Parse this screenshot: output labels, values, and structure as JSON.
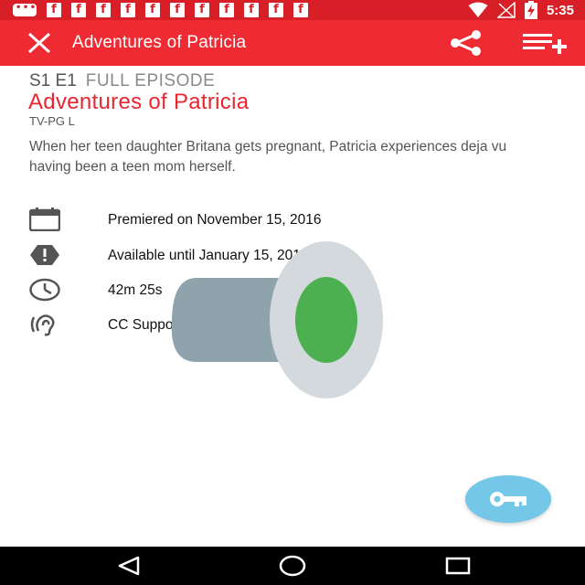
{
  "status_bar": {
    "time": "5:35",
    "icons": [
      "message-icon",
      "facebook-icon",
      "facebook-icon",
      "facebook-icon",
      "facebook-icon",
      "facebook-icon",
      "facebook-icon",
      "facebook-icon",
      "facebook-icon",
      "facebook-icon",
      "facebook-icon",
      "facebook-icon",
      "wifi-icon",
      "signal-off-icon",
      "battery-charging-icon"
    ],
    "fb_glyph": "f"
  },
  "toolbar": {
    "title": "Adventures of Patricia",
    "icons": [
      "close-icon",
      "share-icon",
      "add-to-queue-icon"
    ]
  },
  "episode": {
    "season_episode": "S1 E1",
    "type": "FULL EPISODE",
    "title": "Adventures of Patricia",
    "rating": "TV-PG L",
    "description": "When her teen daughter Britana gets pregnant, Patricia experiences deja vu having been a teen mom herself."
  },
  "details": [
    {
      "icon": "calendar-icon",
      "text": "Premiered on November 15, 2016"
    },
    {
      "icon": "alert-icon",
      "text": "Available until January 15, 2017"
    },
    {
      "icon": "clock-icon",
      "text": "42m 25s"
    },
    {
      "icon": "hearing-icon",
      "text": "CC Supported"
    }
  ],
  "fab": {
    "icon": "key-icon"
  },
  "nav_bar": {
    "icons": [
      "back-icon",
      "home-icon",
      "recents-icon"
    ]
  },
  "colors": {
    "status_bar": "#d81e27",
    "toolbar": "#ee2a33",
    "title_accent": "#e8262f",
    "fab": "#74c7e7",
    "overlay_green": "#4caf50",
    "overlay_gray": "#8fa3ad"
  }
}
